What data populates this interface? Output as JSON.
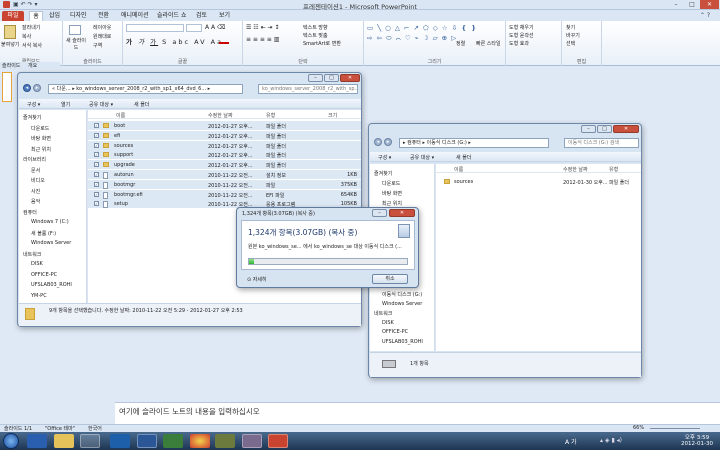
{
  "ppt": {
    "title": "프레젠테이션1 - Microsoft PowerPoint",
    "tabs": [
      "파일",
      "홈",
      "삽입",
      "디자인",
      "전환",
      "애니메이션",
      "슬라이드 쇼",
      "검토",
      "보기"
    ],
    "ribbon": {
      "paste": "붙여넣기",
      "clipboard_label": "클립보드",
      "cut": "잘라내기",
      "copy": "복사",
      "format_painter": "서식 복사",
      "new_slide": "새 슬라이드",
      "layout": "레이아웃",
      "reset": "원래대로",
      "section": "구역",
      "slides_label": "슬라이드",
      "font_label": "글꼴",
      "paragraph_label": "단락",
      "text_direction": "텍스트 방향",
      "align_text": "텍스트 맞춤",
      "smartart": "SmartArt로 변환",
      "drawing_label": "그리기",
      "arrange": "정렬",
      "quick_styles": "빠른 스타일",
      "shape_fill": "도형 채우기",
      "shape_outline": "도형 윤곽선",
      "shape_effects": "도형 효과",
      "find": "찾기",
      "replace": "바꾸기",
      "select": "선택",
      "editing_label": "편집"
    },
    "pane_tabs": [
      "슬라이드",
      "개요"
    ],
    "notes_placeholder": "여기에 슬라이드 노트의 내용을 입력하십시오",
    "status": {
      "slide": "슬라이드 1/1",
      "theme": "\"Office 테마\"",
      "language": "한국어",
      "zoom": "66%"
    }
  },
  "explorer1": {
    "address_path": "« 다운... ▸ ko_windows_server_2008_r2_with_sp1_x64_dvd_6... ▸",
    "search": "ko_windows_server_2008_r2_with_sp...",
    "commands": [
      "구성 ▾",
      "열기",
      "공유 대상 ▾",
      "새 폴더"
    ],
    "nav": [
      {
        "label": "즐겨찾기",
        "sub": false
      },
      {
        "label": "다운로드",
        "sub": true
      },
      {
        "label": "바탕 화면",
        "sub": true
      },
      {
        "label": "최근 위치",
        "sub": true
      },
      {
        "label": "라이브러리",
        "sub": false
      },
      {
        "label": "문서",
        "sub": true
      },
      {
        "label": "비디오",
        "sub": true
      },
      {
        "label": "사진",
        "sub": true
      },
      {
        "label": "음악",
        "sub": true
      },
      {
        "label": "컴퓨터",
        "sub": false
      },
      {
        "label": "Windows 7 (C:)",
        "sub": true
      },
      {
        "label": "새 볼륨 (F:)",
        "sub": true
      },
      {
        "label": "Windows Server",
        "sub": true
      },
      {
        "label": "네트워크",
        "sub": false
      },
      {
        "label": "DISK",
        "sub": true
      },
      {
        "label": "OFFICE-PC",
        "sub": true
      },
      {
        "label": "UFSLAB03_ROHI",
        "sub": true
      },
      {
        "label": "YM-PC",
        "sub": true
      }
    ],
    "columns": [
      "이름",
      "수정한 날짜",
      "유형",
      "크기"
    ],
    "files": [
      {
        "name": "boot",
        "date": "2012-01-27 오후...",
        "type": "파일 폴더",
        "size": "",
        "kind": "folder"
      },
      {
        "name": "efi",
        "date": "2012-01-27 오후...",
        "type": "파일 폴더",
        "size": "",
        "kind": "folder"
      },
      {
        "name": "sources",
        "date": "2012-01-27 오후...",
        "type": "파일 폴더",
        "size": "",
        "kind": "folder"
      },
      {
        "name": "support",
        "date": "2012-01-27 오후...",
        "type": "파일 폴더",
        "size": "",
        "kind": "folder"
      },
      {
        "name": "upgrade",
        "date": "2012-01-27 오후...",
        "type": "파일 폴더",
        "size": "",
        "kind": "folder"
      },
      {
        "name": "autorun",
        "date": "2010-11-22 오전...",
        "type": "설치 정보",
        "size": "1KB",
        "kind": "file"
      },
      {
        "name": "bootmgr",
        "date": "2010-11-22 오전...",
        "type": "파일",
        "size": "375KB",
        "kind": "file"
      },
      {
        "name": "bootmgr.efi",
        "date": "2010-11-22 오전...",
        "type": "EFI 파일",
        "size": "654KB",
        "kind": "file"
      },
      {
        "name": "setup",
        "date": "2010-11-22 오전...",
        "type": "응용 프로그램",
        "size": "105KB",
        "kind": "file"
      }
    ],
    "status": "9개 항목을 선택했습니다. 수정한 날짜: 2010-11-22 오전 5:29 - 2012-01-27 오후 2:53"
  },
  "explorer2": {
    "address_path": "▸ 컴퓨터 ▸ 이동식 디스크 (G:) ▸",
    "search": "이동식 디스크 (G:) 검색",
    "commands": [
      "구성 ▾",
      "공유 대상 ▾",
      "새 폴더"
    ],
    "nav": [
      {
        "label": "즐겨찾기",
        "sub": false
      },
      {
        "label": "다운로드",
        "sub": true
      },
      {
        "label": "바탕 화면",
        "sub": true
      },
      {
        "label": "최근 위치",
        "sub": true
      }
    ],
    "nav_bottom": [
      {
        "label": "이동식 디스크 (G:)",
        "sub": true
      },
      {
        "label": "Windows Server",
        "sub": true
      },
      {
        "label": "네트워크",
        "sub": false
      },
      {
        "label": "DISK",
        "sub": true
      },
      {
        "label": "OFFICE-PC",
        "sub": true
      },
      {
        "label": "UFSLAB03_ROHI",
        "sub": true
      }
    ],
    "columns": [
      "이름",
      "수정한 날짜",
      "유형"
    ],
    "files": [
      {
        "name": "sources",
        "date": "2012-01-30 오후...",
        "type": "파일 폴더"
      }
    ],
    "status": "1개 항목"
  },
  "copy_dialog": {
    "title": "1,324개 항목(3.07GB) (복사 중)",
    "heading": "1,324개 항목(3.07GB) (복사 중)",
    "detail": "원본 ko_windows_se... 에서 ko_windows_se 대상 이동식 디스크 (...",
    "progress": 0.03,
    "more_info": "자세히",
    "cancel": "취소"
  },
  "taskbar": {
    "time": "오후 3:59",
    "date": "2012-01-30",
    "lang": "A 가"
  }
}
